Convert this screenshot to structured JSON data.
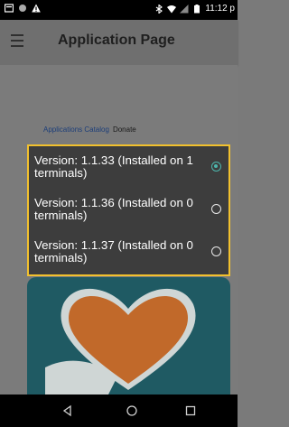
{
  "status_bar": {
    "time": "11:12 p",
    "icons_left": [
      "screen-icon",
      "circle-icon",
      "warning-icon"
    ],
    "icons_right": [
      "bluetooth-icon",
      "wifi-icon",
      "signal-icon",
      "battery-icon"
    ]
  },
  "app_bar": {
    "title": "Application Page",
    "menu_icon": "hamburger-icon"
  },
  "breadcrumb": {
    "link": "Applications Catalog",
    "current": "Donate"
  },
  "versions": [
    {
      "label": "Version: 1.1.33 (Installed on 1 terminals)",
      "selected": true
    },
    {
      "label": "Version: 1.1.36 (Installed on 0 terminals)",
      "selected": false
    },
    {
      "label": "Version: 1.1.37 (Installed on 0 terminals)",
      "selected": false
    }
  ],
  "nav": {
    "back": "back-icon",
    "home": "home-icon",
    "recents": "recents-icon"
  },
  "colors": {
    "highlight": "#f2c12e",
    "radio_selected": "#4db6ac",
    "app_icon_bg": "#1f5a63",
    "heart": "#c1692a"
  }
}
